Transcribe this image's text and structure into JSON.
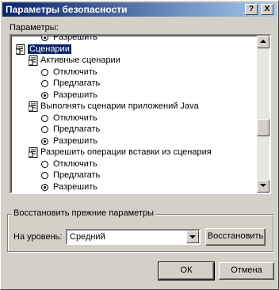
{
  "window": {
    "title": "Параметры безопасности",
    "help_button": "?",
    "close_button": "X"
  },
  "settings_label": "Параметры:",
  "tree": {
    "rows": [
      {
        "kind": "radio",
        "indent": 2,
        "checked": true,
        "label": "Разрешить"
      },
      {
        "kind": "category",
        "indent": 0,
        "label": "Сценарии",
        "selected": true
      },
      {
        "kind": "group",
        "indent": 1,
        "label": "Активные сценарии"
      },
      {
        "kind": "radio",
        "indent": 2,
        "checked": false,
        "label": "Отключить"
      },
      {
        "kind": "radio",
        "indent": 2,
        "checked": false,
        "label": "Предлагать"
      },
      {
        "kind": "radio",
        "indent": 2,
        "checked": true,
        "label": "Разрешить"
      },
      {
        "kind": "group",
        "indent": 1,
        "label": "Выполнять сценарии приложений Java"
      },
      {
        "kind": "radio",
        "indent": 2,
        "checked": false,
        "label": "Отключить"
      },
      {
        "kind": "radio",
        "indent": 2,
        "checked": false,
        "label": "Предлагать"
      },
      {
        "kind": "radio",
        "indent": 2,
        "checked": true,
        "label": "Разрешить"
      },
      {
        "kind": "group",
        "indent": 1,
        "label": "Разрешить операции вставки из сценария"
      },
      {
        "kind": "radio",
        "indent": 2,
        "checked": false,
        "label": "Отключить"
      },
      {
        "kind": "radio",
        "indent": 2,
        "checked": false,
        "label": "Предлагать"
      },
      {
        "kind": "radio",
        "indent": 2,
        "checked": true,
        "label": "Разрешить"
      }
    ],
    "scroll_position": 0.62
  },
  "reset": {
    "legend": "Восстановить прежние параметры",
    "level_label": "На уровень:",
    "level_value": "Средний",
    "restore_button": "Восстановить"
  },
  "footer": {
    "ok_button": "ОК",
    "cancel_button": "Отмена"
  }
}
